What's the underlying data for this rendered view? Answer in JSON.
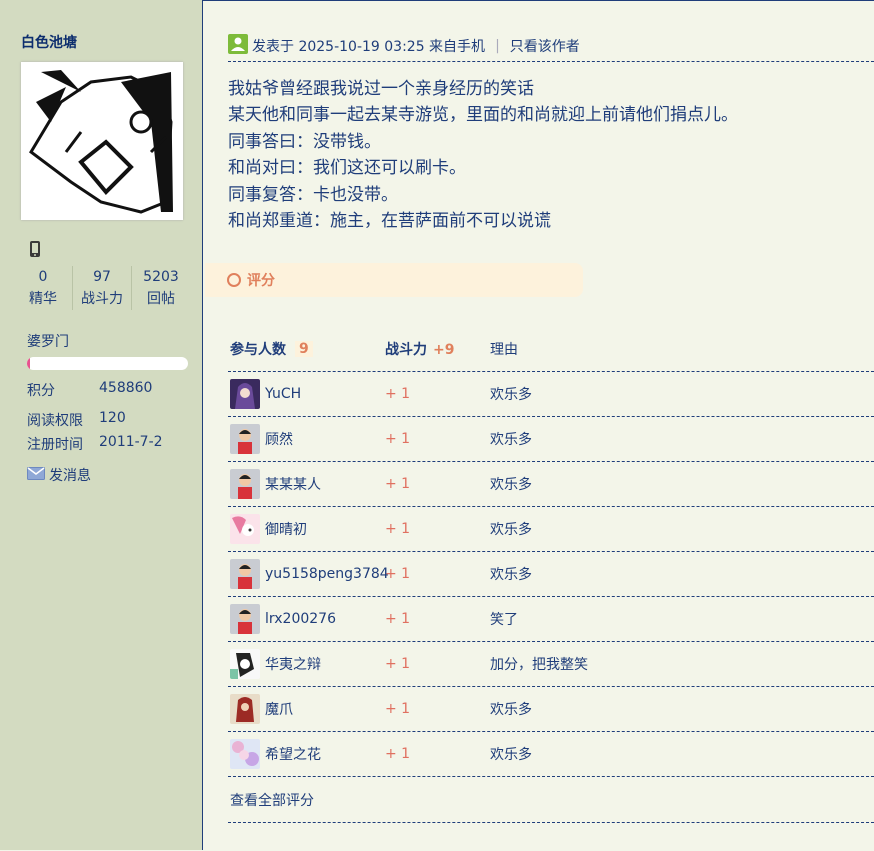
{
  "author": {
    "name": "白色池塘",
    "stats": [
      {
        "value": "0",
        "label": "精华"
      },
      {
        "value": "97",
        "label": "战斗力"
      },
      {
        "value": "5203",
        "label": "回帖"
      }
    ],
    "group": "婆罗门",
    "progress_fraction": 0.02,
    "info": [
      {
        "key": "积分",
        "value": "458860"
      },
      {
        "key": "阅读权限",
        "value": "120"
      },
      {
        "key": "注册时间",
        "value": "2011-7-2"
      }
    ],
    "message_label": "发消息"
  },
  "post": {
    "meta": "发表于 2025-10-19 03:25 来自手机",
    "only_author": "只看该作者",
    "lines": [
      "我姑爷曾经跟我说过一个亲身经历的笑话",
      "某天他和同事一起去某寺游览，里面的和尚就迎上前请他们捐点儿。",
      "同事答曰：没带钱。",
      "和尚对曰：我们这还可以刷卡。",
      "同事复答：卡也没带。",
      "和尚郑重道：施主，在菩萨面前不可以说谎"
    ]
  },
  "rating": {
    "label": "评分",
    "head_participants": "参与人数",
    "participants_count": "9",
    "head_power": "战斗力",
    "power_total": "+9",
    "head_reason": "理由",
    "rows": [
      {
        "user": "YuCH",
        "score": "+ 1",
        "reason": "欢乐多",
        "avatar": "anime-purple"
      },
      {
        "user": "顾然",
        "score": "+ 1",
        "reason": "欢乐多",
        "avatar": "default"
      },
      {
        "user": "某某某人",
        "score": "+ 1",
        "reason": "欢乐多",
        "avatar": "default"
      },
      {
        "user": "御晴初",
        "score": "+ 1",
        "reason": "欢乐多",
        "avatar": "anime-pink"
      },
      {
        "user": "yu5158peng3784",
        "score": "+ 1",
        "reason": "欢乐多",
        "avatar": "default"
      },
      {
        "user": "lrx200276",
        "score": "+ 1",
        "reason": "笑了",
        "avatar": "default"
      },
      {
        "user": "华夷之辩",
        "score": "+ 1",
        "reason": "加分，把我整笑",
        "avatar": "anime-white"
      },
      {
        "user": "魔爪",
        "score": "+ 1",
        "reason": "欢乐多",
        "avatar": "anime-red"
      },
      {
        "user": "希望之花",
        "score": "+ 1",
        "reason": "欢乐多",
        "avatar": "anime-lilac"
      }
    ],
    "view_all": "查看全部评分"
  }
}
